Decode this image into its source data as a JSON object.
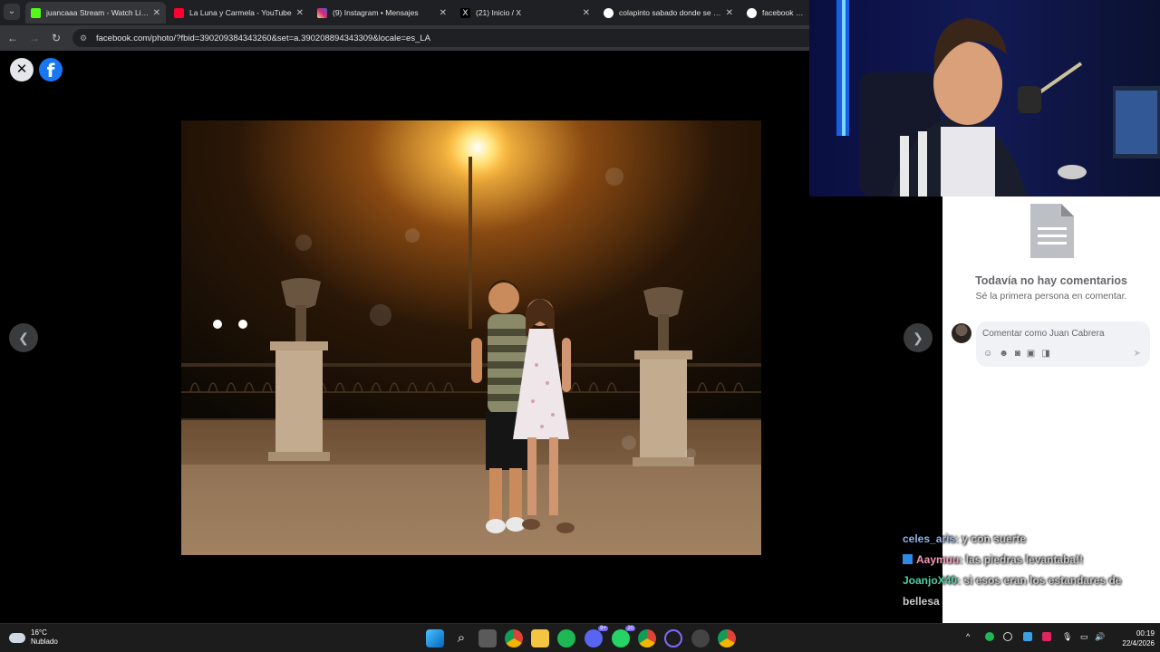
{
  "tabs": [
    {
      "title": "juancaaa Stream - Watch Live o",
      "favicon_color": "#53fc18",
      "active": true
    },
    {
      "title": "La Luna y Carmela - YouTube",
      "favicon_color": "#ff0033",
      "active": false
    },
    {
      "title": "(9) Instagram • Mensajes",
      "favicon_color": "#d62976",
      "active": false
    },
    {
      "title": "(21) Inicio / X",
      "favicon_color": "#000000",
      "active": false
    },
    {
      "title": "colapinto sabado donde se hac",
      "favicon_color": "#e8eaed",
      "active": false
    },
    {
      "title": "facebook - Busc",
      "favicon_color": "#e8eaed",
      "active": false
    }
  ],
  "address": {
    "url": "facebook.com/photo/?fbid=390209384343260&set=a.390208894343309&locale=es_LA"
  },
  "viewer": {
    "close_icon": "close-icon",
    "logo": "f",
    "prev_icon": "chevron-left-icon",
    "next_icon": "chevron-right-icon"
  },
  "comments": {
    "empty_title": "Todavía no hay comentarios",
    "empty_subtitle": "Sé la primera persona en comentar.",
    "input_placeholder": "Comentar como Juan Cabrera",
    "tool_icons": [
      "avatar-sticker-icon",
      "emoji-icon",
      "camera-icon",
      "gif-icon",
      "sticker-icon"
    ]
  },
  "chat": [
    {
      "user": "celes_aris",
      "user_color": "#8fb4e8",
      "message": ": y con suerte",
      "badge": false
    },
    {
      "user": "Aaymuu",
      "user_color": "#f09ab5",
      "message": ": las piedras levantaba!!",
      "badge": true
    },
    {
      "user": "JoanjoX40",
      "user_color": "#4fd1a5",
      "message": ": si esos eran los estandares de bellesa",
      "badge": false
    }
  ],
  "taskbar": {
    "temperature": "16°C",
    "condition": "Nublado",
    "time": "00:19",
    "date": "22/4/2026",
    "discord_badge": "9+",
    "whatsapp_badge": "20"
  }
}
